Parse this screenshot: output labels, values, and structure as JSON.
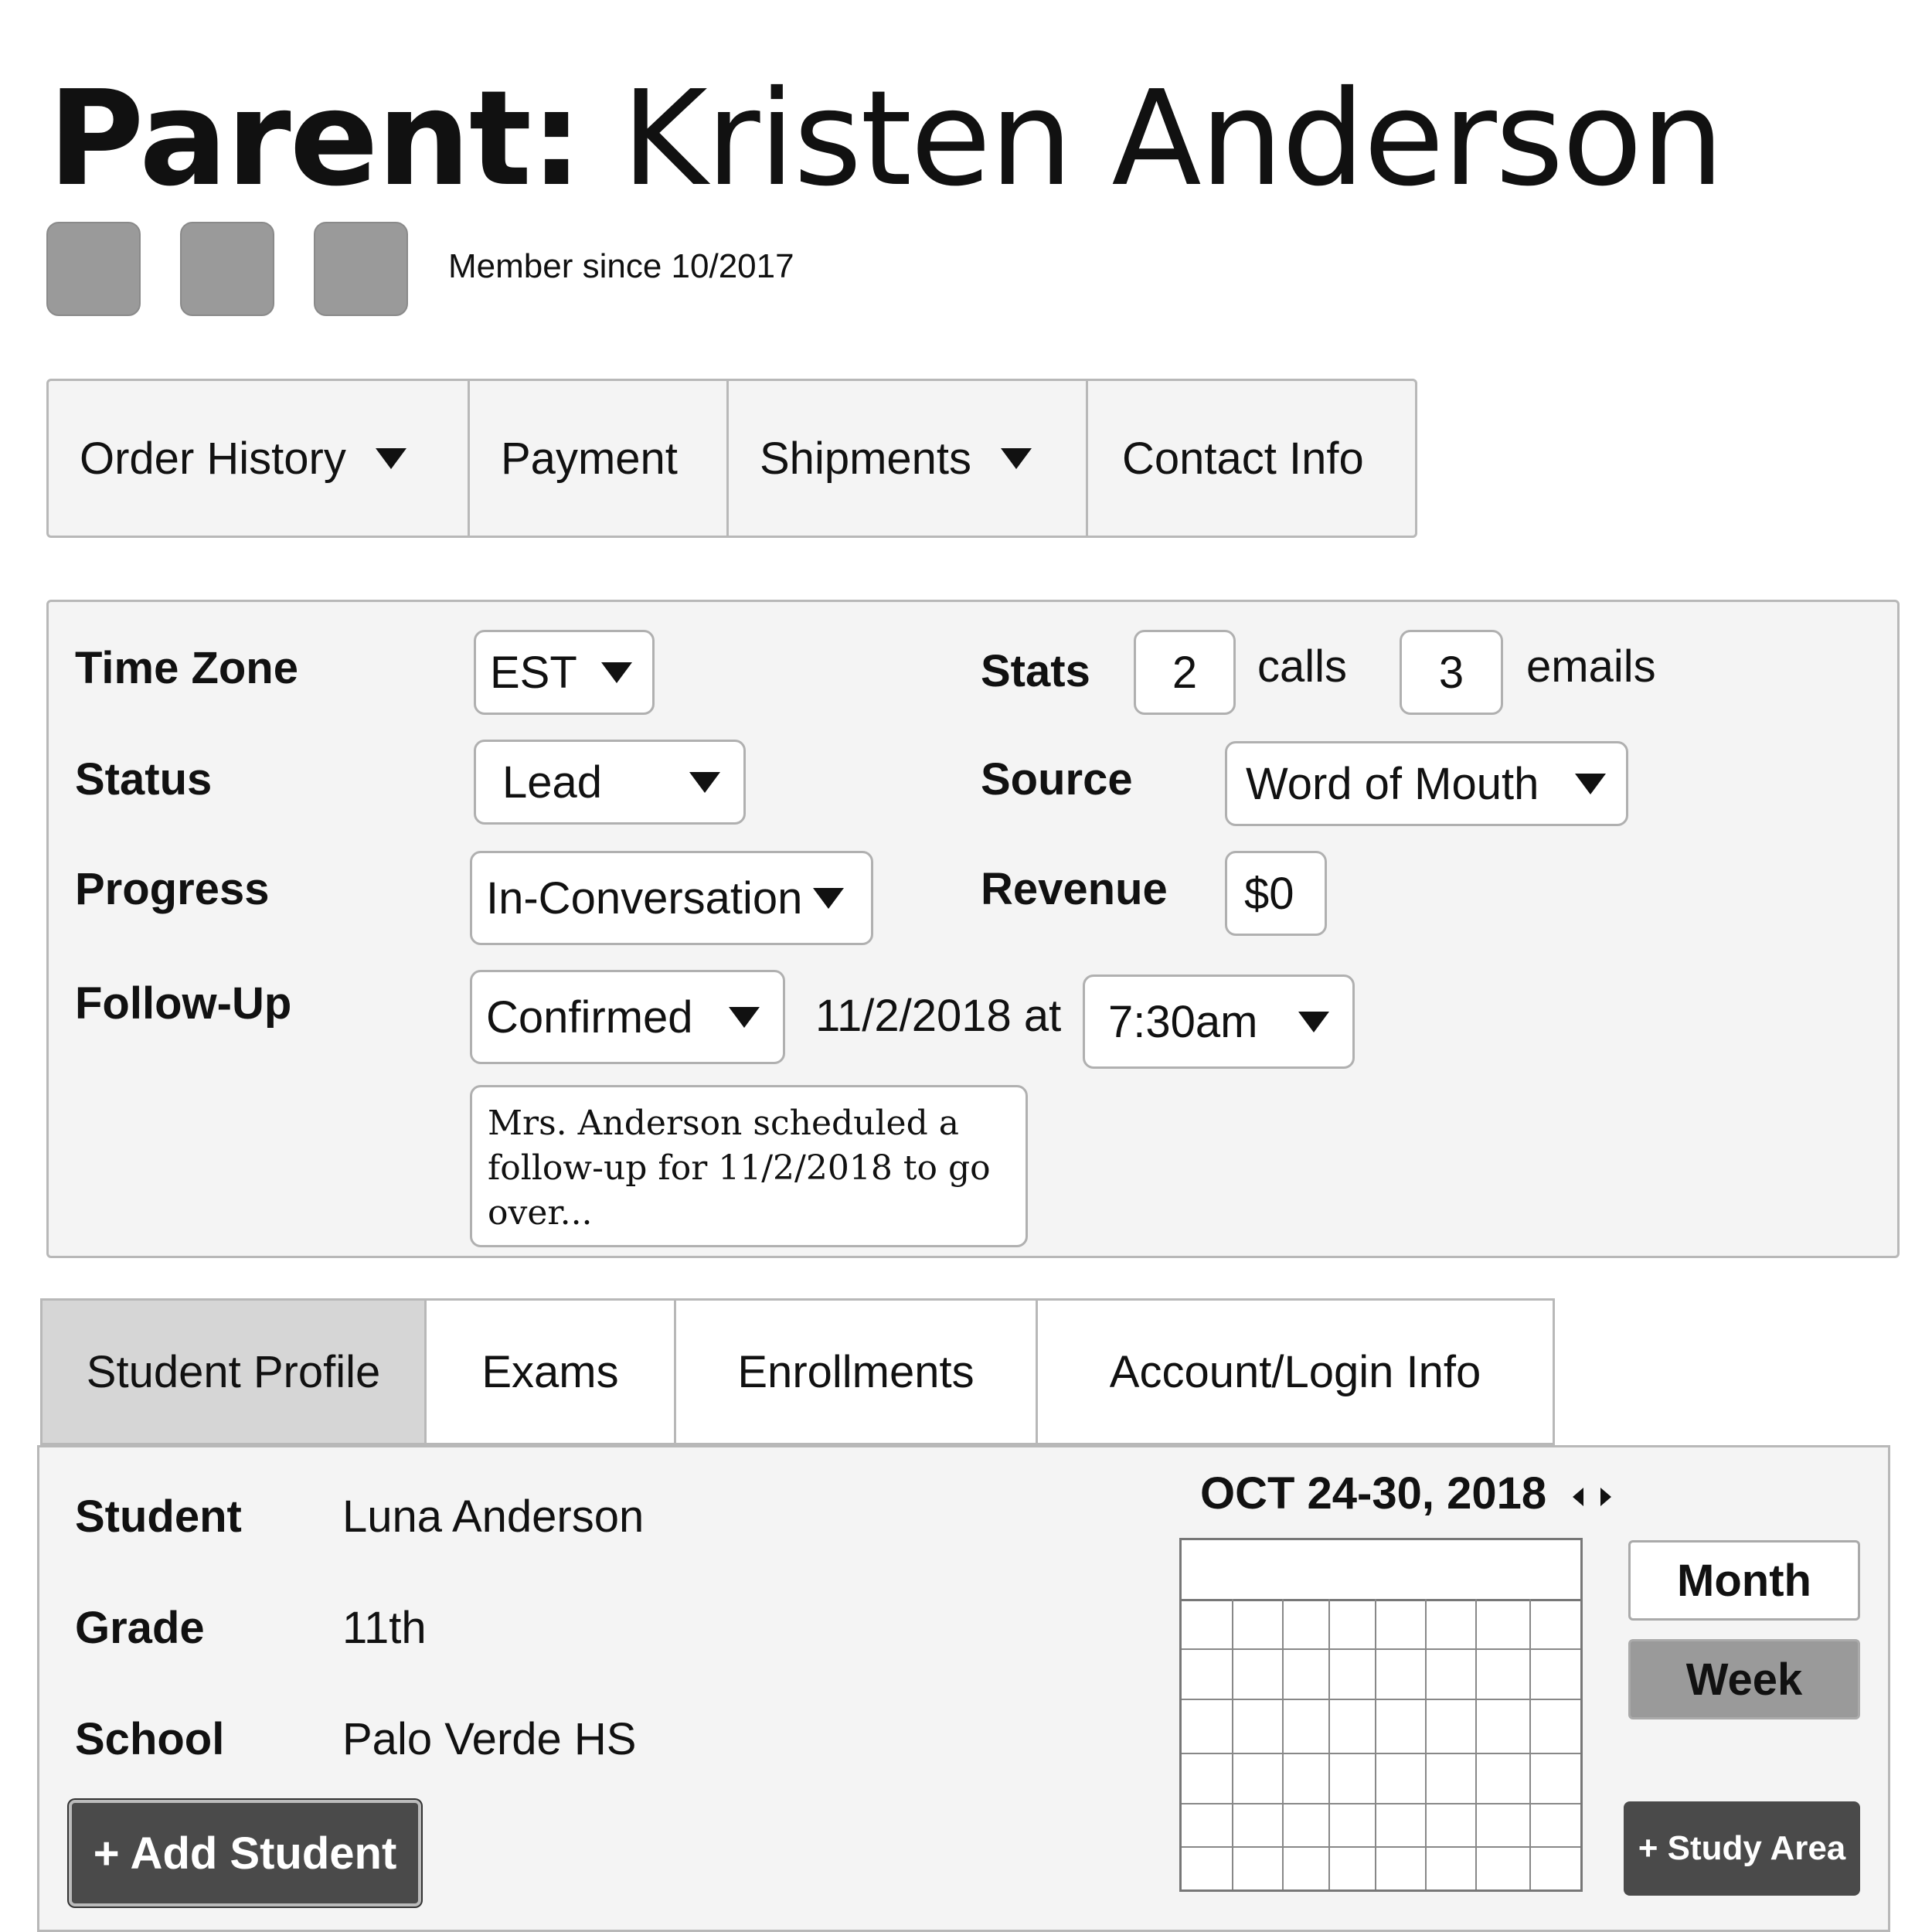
{
  "header": {
    "title_prefix": "Parent:",
    "title_name": "Kristen Anderson",
    "member_since": "Member since 10/2017"
  },
  "top_nav": {
    "items": [
      {
        "label": "Order History",
        "dropdown": true
      },
      {
        "label": "Payment",
        "dropdown": false
      },
      {
        "label": "Shipments",
        "dropdown": true
      },
      {
        "label": "Contact Info",
        "dropdown": false
      }
    ]
  },
  "info": {
    "time_zone": {
      "label": "Time Zone",
      "value": "EST"
    },
    "status": {
      "label": "Status",
      "value": "Lead"
    },
    "progress": {
      "label": "Progress",
      "value": "In-Conversation"
    },
    "follow_up": {
      "label": "Follow-Up",
      "value": "Confirmed",
      "date_text": "11/2/2018 at",
      "time": "7:30am",
      "note": "Mrs. Anderson scheduled a follow-up for 11/2/2018 to go over..."
    },
    "stats": {
      "label": "Stats",
      "calls_count": "2",
      "calls_label": "calls",
      "emails_count": "3",
      "emails_label": "emails"
    },
    "source": {
      "label": "Source",
      "value": "Word of Mouth"
    },
    "revenue": {
      "label": "Revenue",
      "value": "$0"
    }
  },
  "bottom_tabs": {
    "items": [
      {
        "label": "Student Profile",
        "active": true
      },
      {
        "label": "Exams",
        "active": false
      },
      {
        "label": "Enrollments",
        "active": false
      },
      {
        "label": "Account/Login Info",
        "active": false
      }
    ]
  },
  "student": {
    "student_label": "Student",
    "student_value": "Luna Anderson",
    "grade_label": "Grade",
    "grade_value": "11th",
    "school_label": "School",
    "school_value": "Palo Verde HS",
    "add_button": "+ Add Student"
  },
  "calendar": {
    "range": "OCT 24-30, 2018",
    "month_label": "Month",
    "week_label": "Week",
    "active_view": "Week",
    "study_area_button": "+ Study Area"
  },
  "colors": {
    "panel_bg": "#f4f4f4",
    "active_tab": "#d6d6d6",
    "dark_button": "#4a4a4a",
    "active_toggle": "#9a9a9a",
    "icon_placeholder": "#9a9a9a"
  }
}
